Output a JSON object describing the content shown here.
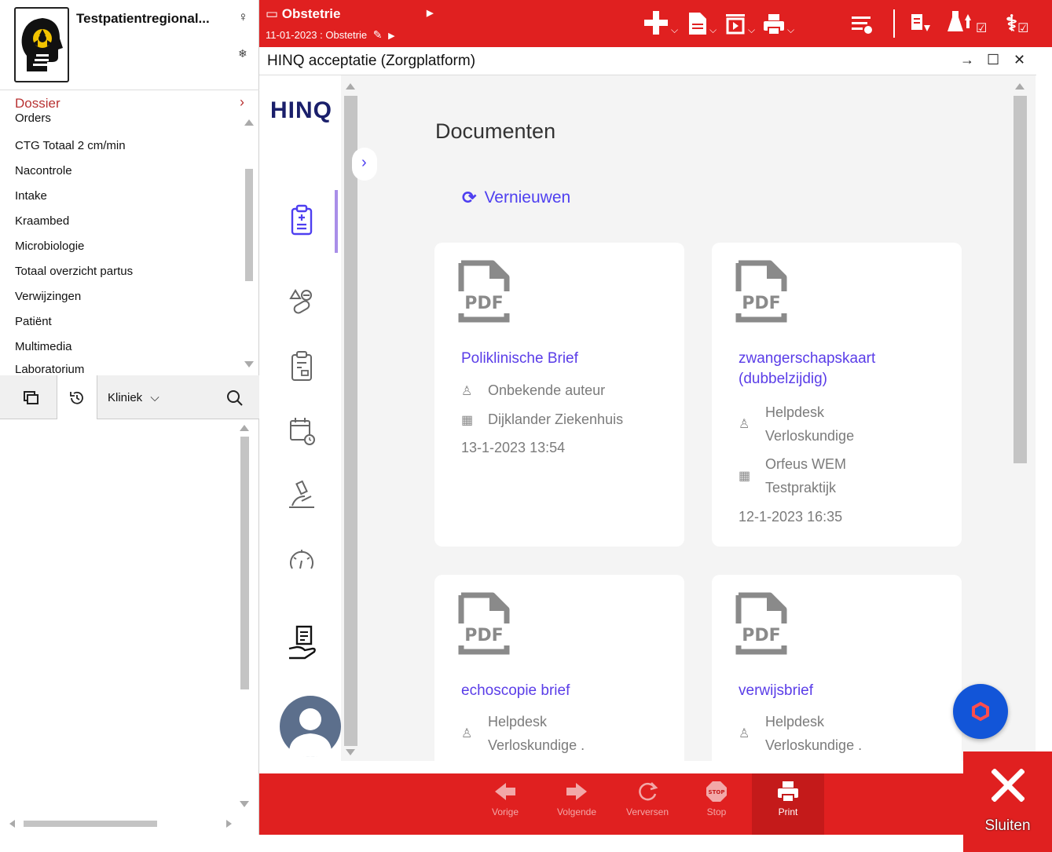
{
  "patient": {
    "name": "Testpatientregional...",
    "gender_symbol": "♀",
    "flag_symbol": "❄"
  },
  "sidebar": {
    "section": "Dossier",
    "items": [
      "Orders",
      "CTG Totaal 2 cm/min",
      "Nacontrole",
      "Intake",
      "Kraambed",
      "Microbiologie",
      "Totaal overzicht partus",
      "Verwijzingen",
      "Patiënt",
      "Multimedia",
      "Laboratorium"
    ],
    "filter_label": "Kliniek"
  },
  "header": {
    "folder": "Obstetrie",
    "episode": "11-01-2023 : Obstetrie"
  },
  "window": {
    "title": "HINQ acceptatie (Zorgplatform)"
  },
  "hinq": {
    "logo": "HINQ",
    "heading": "Documenten",
    "refresh_label": "Vernieuwen",
    "cards": [
      {
        "title": "Poliklinische Brief",
        "author": "Onbekende auteur",
        "organization": "Dijklander Ziekenhuis",
        "date": "13-1-2023 13:54"
      },
      {
        "title": "zwangerschapskaart (dubbelzijdig)",
        "author": "Helpdesk Verloskundige",
        "organization": "Orfeus WEM Testpraktijk",
        "date": "12-1-2023 16:35"
      },
      {
        "title": "echoscopie brief",
        "author": "Helpdesk Verloskundige ."
      },
      {
        "title": "verwijsbrief",
        "author": "Helpdesk Verloskundige ."
      }
    ],
    "pdf_label": "PDF"
  },
  "toolbar": {
    "back": "Vorige",
    "forward": "Volgende",
    "refresh": "Verversen",
    "stop": "Stop",
    "stop_sign": "STOP",
    "print": "Print",
    "close": "Sluiten"
  },
  "colors": {
    "brand_red": "#e02020",
    "link_purple": "#5a3de8",
    "fab_blue": "#1255d8"
  }
}
